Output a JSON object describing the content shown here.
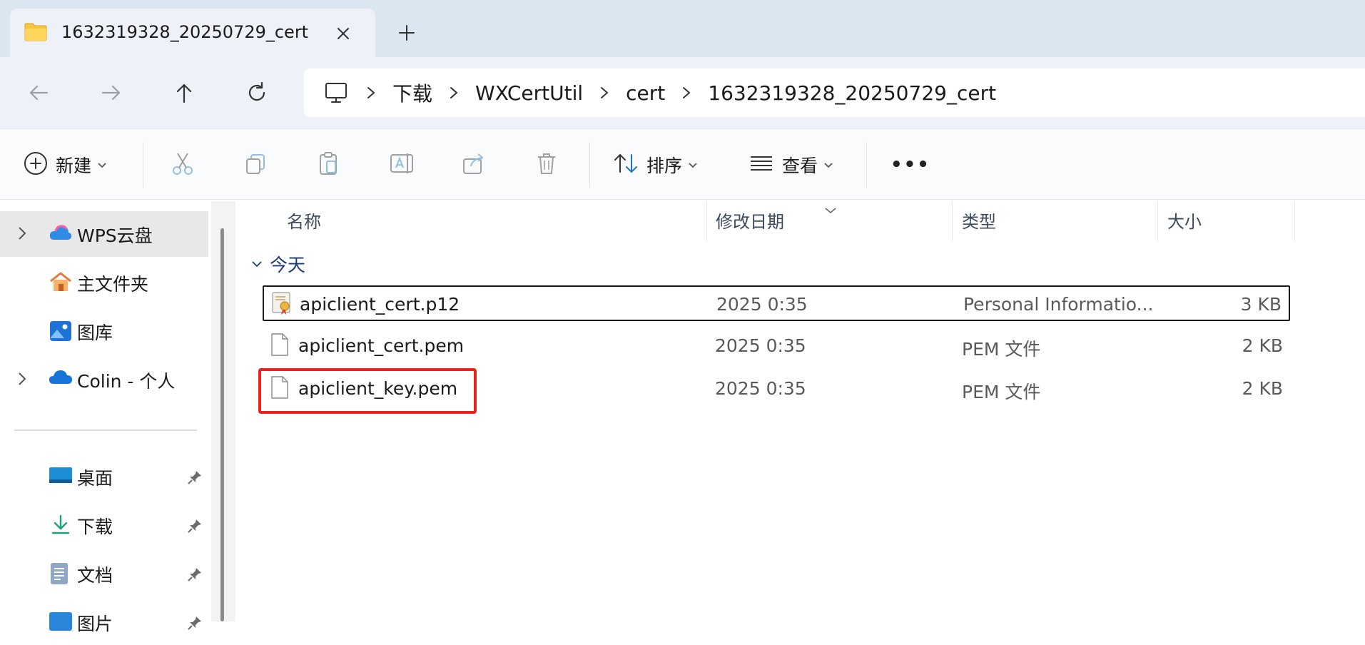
{
  "tab": {
    "title": "1632319328_20250729_cert"
  },
  "breadcrumb": [
    "下载",
    "WXCertUtil",
    "cert",
    "1632319328_20250729_cert"
  ],
  "toolbar": {
    "new_label": "新建",
    "sort_label": "排序",
    "view_label": "查看",
    "more_label": "•••"
  },
  "sidebar": {
    "items": [
      {
        "label": "WPS云盘",
        "icon": "cloud-icon"
      },
      {
        "label": "主文件夹",
        "icon": "home-icon"
      },
      {
        "label": "图库",
        "icon": "gallery-icon"
      },
      {
        "label": "Colin - 个人",
        "icon": "onedrive-icon"
      }
    ],
    "quick": [
      {
        "label": "桌面",
        "icon": "desktop-icon"
      },
      {
        "label": "下载",
        "icon": "download-icon"
      },
      {
        "label": "文档",
        "icon": "documents-icon"
      },
      {
        "label": "图片",
        "icon": "pictures-icon"
      }
    ]
  },
  "columns": {
    "name": "名称",
    "date": "修改日期",
    "type": "类型",
    "size": "大小"
  },
  "group": {
    "label": "今天"
  },
  "files": [
    {
      "name": "apiclient_cert.p12",
      "date": "2025 0:35",
      "type": "Personal Informatio...",
      "size": "3 KB",
      "icon": "certificate-icon"
    },
    {
      "name": "apiclient_cert.pem",
      "date": "2025 0:35",
      "type": "PEM 文件",
      "size": "2 KB",
      "icon": "file-icon"
    },
    {
      "name": "apiclient_key.pem",
      "date": "2025 0:35",
      "type": "PEM 文件",
      "size": "2 KB",
      "icon": "file-icon"
    }
  ],
  "colors": {
    "highlight": "#e8231f",
    "accent": "#1a3e72"
  }
}
